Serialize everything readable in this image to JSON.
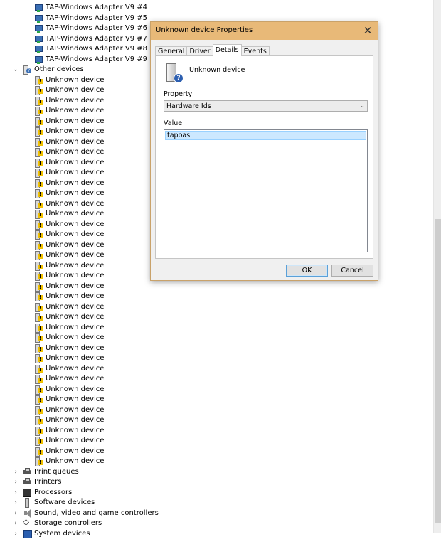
{
  "tree": {
    "tap_adapters": [
      "TAP-Windows Adapter V9 #4",
      "TAP-Windows Adapter V9 #5",
      "TAP-Windows Adapter V9 #6",
      "TAP-Windows Adapter V9 #7",
      "TAP-Windows Adapter V9 #8",
      "TAP-Windows Adapter V9 #9"
    ],
    "other_devices": {
      "label": "Other devices",
      "expanded": true,
      "children_label": "Unknown device",
      "children_count": 38
    },
    "categories": [
      {
        "label": "Print queues",
        "icon": "printer-icon"
      },
      {
        "label": "Printers",
        "icon": "printer-icon"
      },
      {
        "label": "Processors",
        "icon": "processor-icon"
      },
      {
        "label": "Software devices",
        "icon": "software-device-icon"
      },
      {
        "label": "Sound, video and game controllers",
        "icon": "speaker-icon"
      },
      {
        "label": "Storage controllers",
        "icon": "storage-controller-icon"
      },
      {
        "label": "System devices",
        "icon": "system-device-icon"
      }
    ]
  },
  "dialog": {
    "title": "Unknown device Properties",
    "close_glyph": "✕",
    "tabs": [
      {
        "label": "General",
        "active": false
      },
      {
        "label": "Driver",
        "active": false
      },
      {
        "label": "Details",
        "active": true
      },
      {
        "label": "Events",
        "active": false
      }
    ],
    "device_name": "Unknown device",
    "property_label": "Property",
    "property_selected": "Hardware Ids",
    "value_label": "Value",
    "values": [
      "tapoas"
    ],
    "ok_label": "OK",
    "cancel_label": "Cancel"
  },
  "scrollbar": {
    "position_fraction": 0.41
  }
}
